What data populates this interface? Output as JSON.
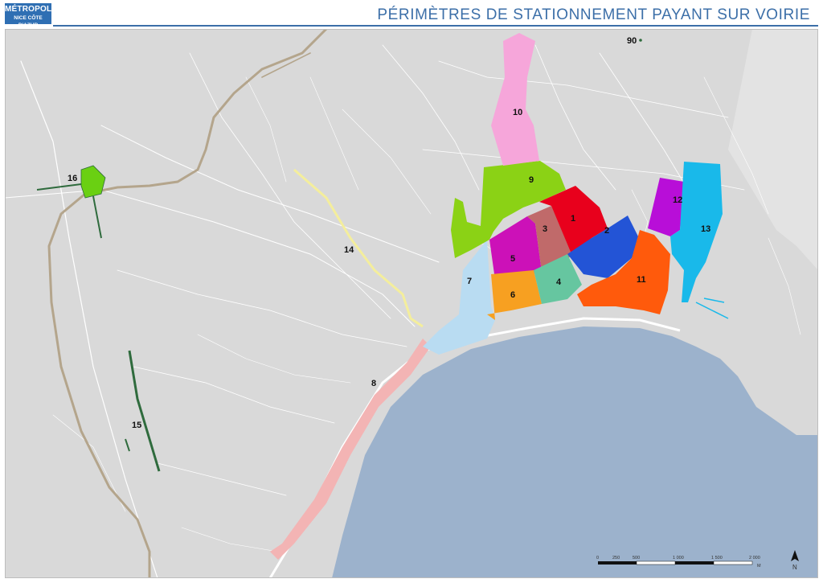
{
  "header": {
    "logo_line1": "MÉTROPOLE",
    "logo_line2": "NICE CÔTE D'AZUR",
    "title": "PÉRIMÈTRES DE STATIONNEMENT PAYANT SUR VOIRIE"
  },
  "map": {
    "land_color": "#d9d9d9",
    "sea_color": "#9cb2cc",
    "road_color": "#ffffff",
    "railway_color": "#b4a58c",
    "zones": [
      {
        "id": "1",
        "label": "1",
        "color": "#e8001c"
      },
      {
        "id": "2",
        "label": "2",
        "color": "#2354d6"
      },
      {
        "id": "3",
        "label": "3",
        "color": "#c06a6a"
      },
      {
        "id": "4",
        "label": "4",
        "color": "#66c6a0"
      },
      {
        "id": "5",
        "label": "5",
        "color": "#cc11b8"
      },
      {
        "id": "6",
        "label": "6",
        "color": "#f7a021"
      },
      {
        "id": "7",
        "label": "7",
        "color": "#b9dcf2"
      },
      {
        "id": "8",
        "label": "8",
        "color": "#f3b4b4"
      },
      {
        "id": "9",
        "label": "9",
        "color": "#8bd215"
      },
      {
        "id": "10",
        "label": "10",
        "color": "#f6a6da"
      },
      {
        "id": "11",
        "label": "11",
        "color": "#ff5a0c"
      },
      {
        "id": "12",
        "label": "12",
        "color": "#b80ed8"
      },
      {
        "id": "13",
        "label": "13",
        "color": "#19b9ea"
      },
      {
        "id": "14",
        "label": "14",
        "color": "#f4ee9c"
      },
      {
        "id": "15",
        "label": "15",
        "color": "#2f6b3d"
      },
      {
        "id": "16",
        "label": "16",
        "color": "#6ad012"
      },
      {
        "id": "90",
        "label": "90",
        "color": "#2f6b3d"
      }
    ]
  },
  "scale_bar": {
    "ticks": [
      "0",
      "250",
      "500",
      "1 000",
      "1 500",
      "2 000"
    ],
    "unit": "M"
  },
  "north_arrow": {
    "label": "N"
  }
}
